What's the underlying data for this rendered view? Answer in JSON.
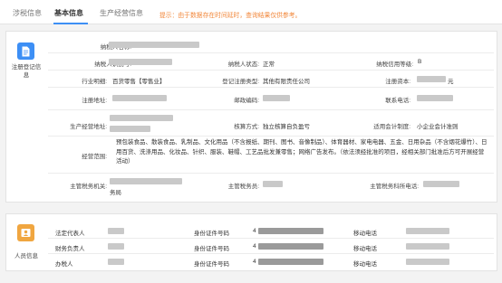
{
  "tabs": [
    {
      "label": "涉税信息"
    },
    {
      "label": "基本信息"
    },
    {
      "label": "生产经营信息"
    }
  ],
  "notice": "提示：由于数据存在时间延时，查询结果仅供参考。",
  "registration": {
    "section_label": "注册登记信息",
    "fields": {
      "taxpayer_name": "纳税人名称:",
      "taxpayer_id": "纳税人识别号:",
      "taxpayer_status": "纳税人状态:",
      "status_value": "正常",
      "credit_level": "纳税信用等级:",
      "credit_value": "B",
      "industry": "行业明细:",
      "industry_value": "百货零售【零售业】",
      "reg_type": "登记注册类型:",
      "reg_type_value": "其他有限责任公司",
      "reg_capital": "注册资本:",
      "reg_capital_suffix": "元",
      "reg_address": "注册地址:",
      "postcode": "邮政编码:",
      "phone": "联系电话:",
      "biz_address": "生产经营地址:",
      "accounting": "核算方式:",
      "accounting_value": "独立核算自负盈亏",
      "standard": "适用会计制度:",
      "standard_value": "小企业会计准则",
      "scope": "经营范围:",
      "scope_value": "预包装食品、散装食品、乳制品、文化用品（不含报纸、期刊、图书、音像制品）、体育器材、家电电器、五金、日用杂品（不含烟花爆竹）、日用百货、洗涤用品、化妆品、针织、服装、鞋帽、工艺品批发兼零售；网络广告发布。（依法须经批准的项目，经相关部门批准后方可开展经营活动）",
      "tax_authority": "主管税务机关:",
      "tax_authority_suffix": "务局",
      "tax_officer": "主管税务员:",
      "tax_branch": "主管税务科所电话:"
    }
  },
  "personnel": {
    "section_label": "人员信息",
    "rows": [
      {
        "role": "法定代表人",
        "id_label": "身份证件号码",
        "phone_label": "移动电话",
        "id_prefix": "4"
      },
      {
        "role": "财务负责人",
        "id_label": "身份证件号码",
        "phone_label": "移动电话",
        "id_prefix": "4"
      },
      {
        "role": "办税人",
        "id_label": "身份证件号码",
        "phone_label": "移动电话",
        "id_prefix": "4"
      }
    ]
  },
  "colors": {
    "accent": "#3d8ff5",
    "notice": "#f2873a",
    "person_icon": "#f0a640"
  },
  "icons": {
    "registration": "document-icon",
    "personnel": "person-card-icon"
  }
}
